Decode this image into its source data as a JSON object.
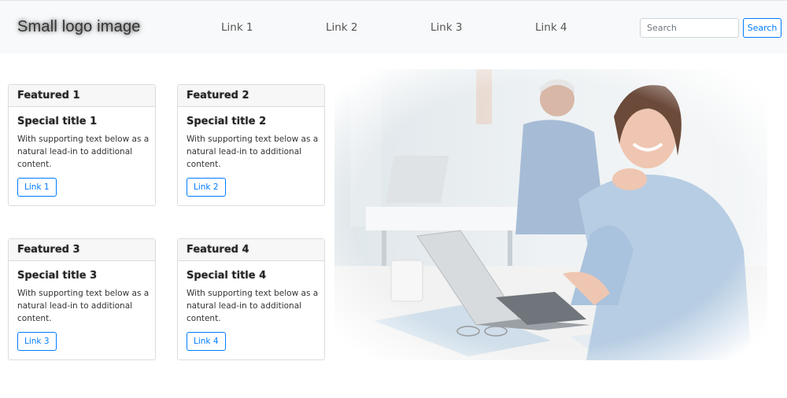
{
  "navbar": {
    "logo_text": "Small logo image",
    "links": [
      "Link 1",
      "Link 2",
      "Link 3",
      "Link 4"
    ],
    "search": {
      "placeholder": "Search",
      "button_label": "Search"
    }
  },
  "cards": [
    {
      "header": "Featured 1",
      "title": "Special title 1",
      "text": "With supporting text below as a natural lead-in to additional content.",
      "link": "Link 1"
    },
    {
      "header": "Featured 2",
      "title": "Special title 2",
      "text": "With supporting text below as a natural lead-in to additional content.",
      "link": "Link 2"
    },
    {
      "header": "Featured 3",
      "title": "Special title 3",
      "text": "With supporting text below as a natural lead-in to additional content.",
      "link": "Link 3"
    },
    {
      "header": "Featured 4",
      "title": "Special title 4",
      "text": "With supporting text below as a natural lead-in to additional content.",
      "link": "Link 4"
    }
  ],
  "colors": {
    "primary": "#007bff",
    "navbar_bg": "#f8f9fa"
  }
}
